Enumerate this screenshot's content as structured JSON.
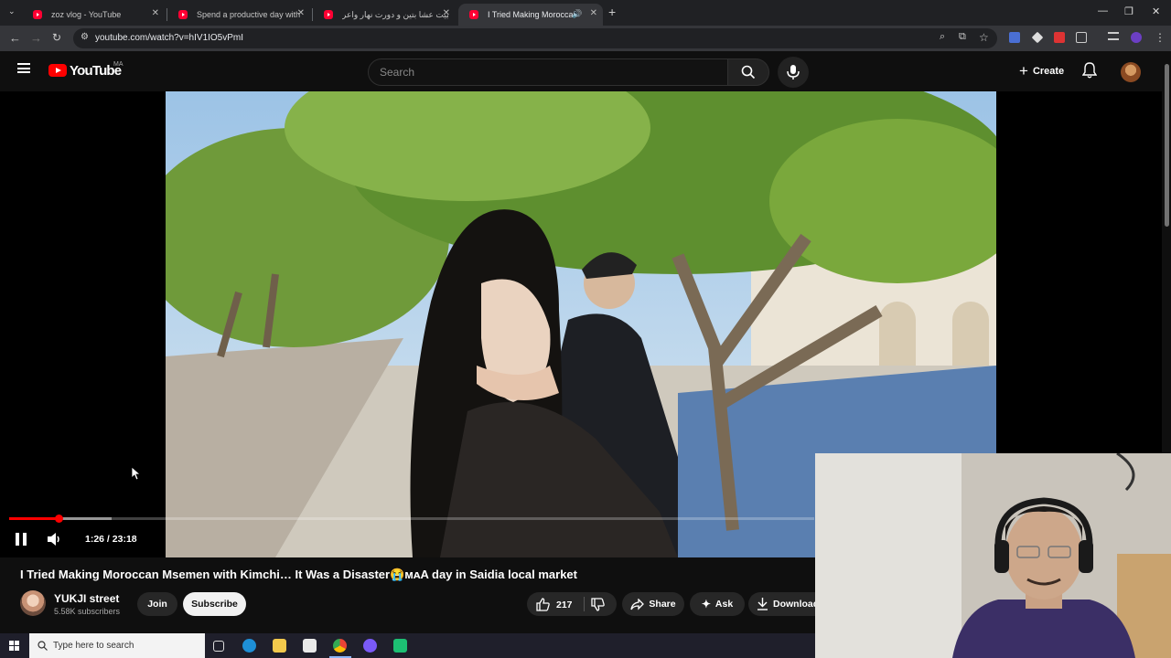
{
  "browser": {
    "tabs": [
      {
        "label": "zoz vlog - YouTube"
      },
      {
        "label": "Spend a productive day with m"
      },
      {
        "label": "طبيت عشا بتين و دورت نهار واعر"
      },
      {
        "label": "I Tried Making Moroccan M"
      }
    ],
    "url": "youtube.com/watch?v=hIV1IO5vPmI"
  },
  "youtube": {
    "logo_text": "YouTube",
    "country_code": "MA",
    "search_placeholder": "Search",
    "create_label": "Create"
  },
  "player": {
    "time_display": "1:26 / 23:18",
    "progress_fraction": 0.0615,
    "buffered_fraction": 0.127
  },
  "video": {
    "title": "I Tried Making Moroccan Msemen with Kimchi… It Was a Disaster😭ᴍᴀA day in Saidia local market",
    "channel_name": "YUKJI street",
    "subscribers": "5.58K subscribers",
    "join_label": "Join",
    "subscribe_label": "Subscribe",
    "likes": "217",
    "share_label": "Share",
    "ask_label": "Ask",
    "download_label": "Download"
  },
  "taskbar": {
    "search_placeholder": "Type here to search"
  },
  "colors": {
    "youtube_red": "#ff0000",
    "background": "#0f0f0f",
    "button_bg": "#272727"
  }
}
